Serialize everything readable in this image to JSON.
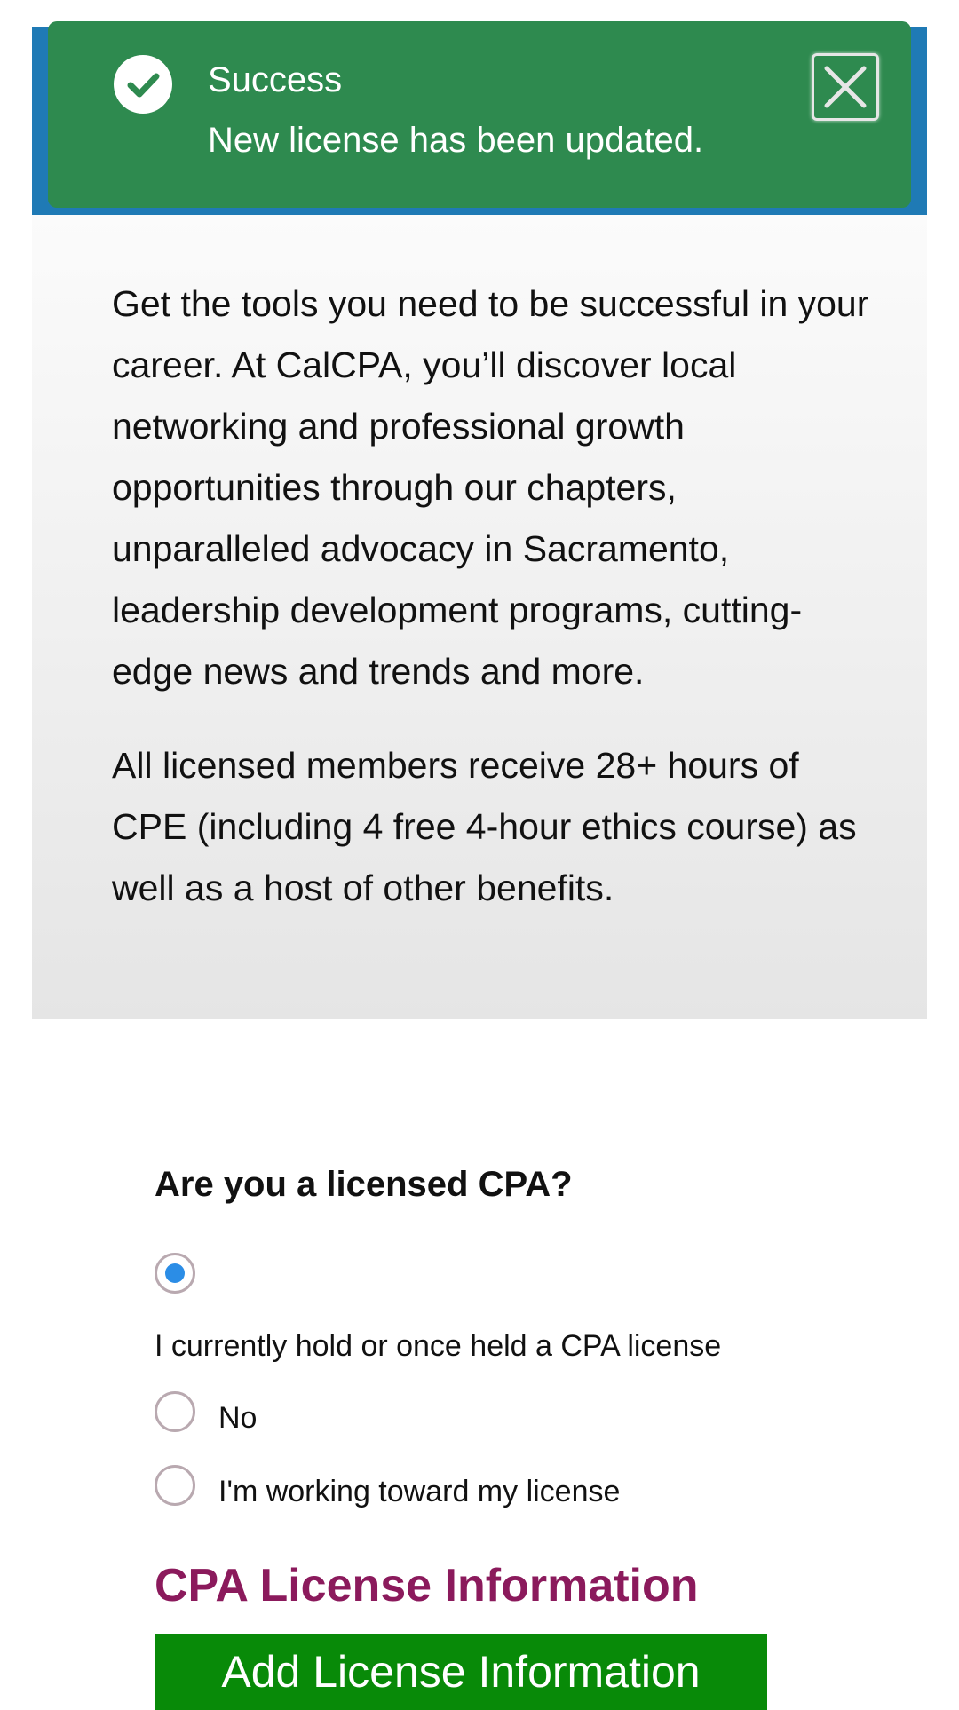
{
  "toast": {
    "title": "Success",
    "message": "New license has been updated.",
    "icon": "check-circle-icon",
    "close_icon": "close-icon",
    "color": "#2e8a4f"
  },
  "intro": {
    "paragraph1": "Get the tools you need to be successful in your career. At CalCPA, you’ll discover local networking and professional growth opportunities through our chapters, unparalleled advocacy in Sacramento, leadership development programs, cutting-edge news and trends and more.",
    "paragraph2": "All licensed members receive 28+ hours of CPE (including 4 free 4-hour ethics course) as well as a host of other benefits."
  },
  "question": {
    "label": "Are you a licensed CPA?",
    "options": [
      {
        "label": "I currently hold or once held a CPA license",
        "selected": true
      },
      {
        "label": "No",
        "selected": false
      },
      {
        "label": "I'm working toward my license",
        "selected": false
      }
    ]
  },
  "license_section": {
    "title": "CPA License Information",
    "add_button_label": "Add License Information",
    "title_color": "#8b1a5c",
    "button_color": "#088a08"
  }
}
